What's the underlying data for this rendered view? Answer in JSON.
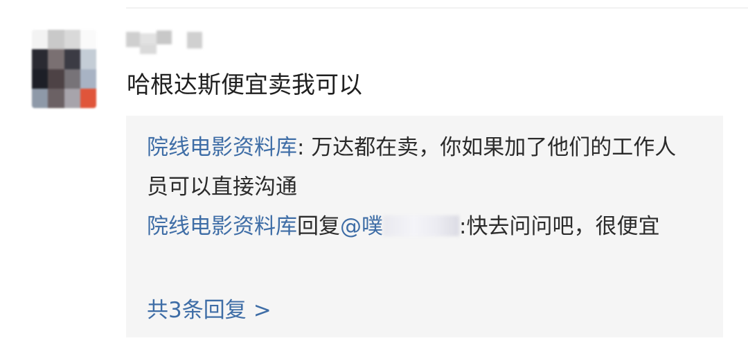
{
  "comment": {
    "text": "哈根达斯便宜卖我可以"
  },
  "replies": [
    {
      "author": "院线电影资料库",
      "separator": ": ",
      "text": "万达都在卖，你如果加了他们的工作人员可以直接沟通"
    },
    {
      "author": "院线电影资料库",
      "reply_word": "回复",
      "mention_visible": "@噗",
      "separator": ":",
      "text": "快去问问吧，很便宜"
    }
  ],
  "more_replies": {
    "label": "共3条回复",
    "chevron": ">"
  },
  "colors": {
    "link": "#3e6da6",
    "text": "#1f1f1f",
    "reply_bg": "#f5f5f5"
  }
}
